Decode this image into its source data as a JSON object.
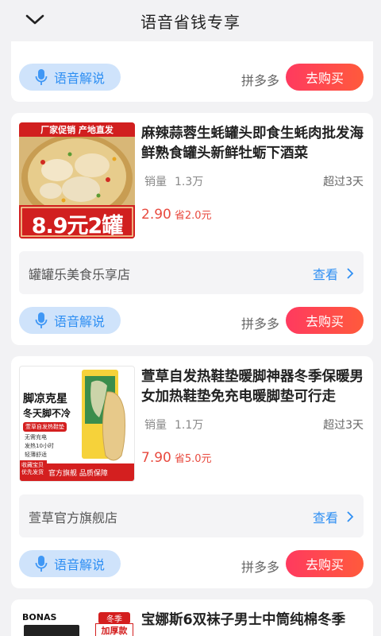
{
  "header": {
    "title": "语音省钱专享"
  },
  "common": {
    "voice_label": "语音解说",
    "buy_label": "去购买",
    "view_label": "查看",
    "sales_label": "销量"
  },
  "cards": [
    {
      "platform": "拼多多"
    },
    {
      "title": "麻辣蒜蓉生蚝罐头即食生蚝肉批发海鲜熟食罐头新鲜牡蛎下酒菜",
      "sales": "1.3万",
      "days": "超过3天",
      "price": "2.90",
      "save": "省2.0元",
      "shop": "罐罐乐美食乐享店",
      "platform": "拼多多",
      "image": {
        "badge": "厂家促销 产地直发",
        "banner": "8.9元2罐"
      }
    },
    {
      "title": "萱草自发热鞋垫暖脚神器冬季保暖男女加热鞋垫免充电暖脚垫可行走",
      "sales": "1.1万",
      "days": "超过3天",
      "price": "7.90",
      "save": "省5.0元",
      "shop": "萱草官方旗舰店",
      "platform": "拼多多",
      "image": {
        "headline1": "脚凉克星",
        "headline2": "冬天脚不冷",
        "tag": "萱草自发热鞋垫",
        "bullets": [
          "无需充电",
          "发热10小时",
          "轻薄舒适"
        ],
        "corner": "收藏宝贝 优先发货",
        "footer": "官方旗舰 品质保障"
      }
    },
    {
      "title": "宝娜斯6双袜子男士中筒纯棉冬季",
      "image": {
        "brand": "BONAS",
        "tag1": "冬季",
        "tag2": "加厚款"
      }
    }
  ]
}
